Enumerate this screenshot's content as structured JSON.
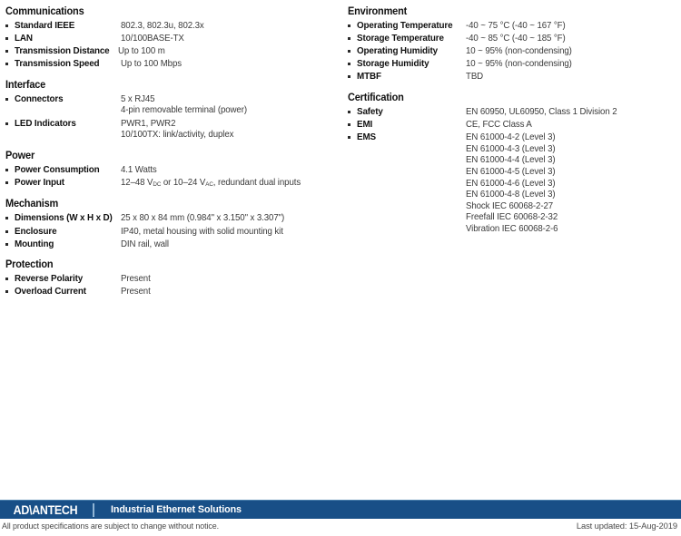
{
  "document": {
    "type": "product-specification-sheet"
  },
  "left_column": [
    {
      "title": "Communications",
      "rows": [
        {
          "label": "Standard IEEE",
          "values": [
            "802.3, 802.3u, 802.3x"
          ]
        },
        {
          "label": "LAN",
          "values": [
            "10/100BASE-TX"
          ]
        },
        {
          "label": "Transmission Distance",
          "values": [
            "Up to 100 m"
          ],
          "wide_label": true
        },
        {
          "label": "Transmission Speed",
          "values": [
            "Up to 100 Mbps"
          ]
        }
      ]
    },
    {
      "title": "Interface",
      "rows": [
        {
          "label": "Connectors",
          "values": [
            "5 x RJ45",
            "4-pin removable terminal (power)"
          ]
        },
        {
          "label": "LED Indicators",
          "values": [
            "PWR1, PWR2",
            "10/100TX: link/activity, duplex"
          ]
        }
      ]
    },
    {
      "title": "Power",
      "rows": [
        {
          "label": "Power Consumption",
          "values": [
            "4.1 Watts"
          ]
        },
        {
          "label": "Power Input",
          "values_html": [
            "12–48 V<sub>DC</sub> or 10–24 V<sub>AC</sub>, redundant dual inputs"
          ]
        }
      ]
    },
    {
      "title": "Mechanism",
      "rows": [
        {
          "label": "Dimensions (W x H x D)",
          "values": [
            "25 x 80 x 84 mm (0.984\" x 3.150\" x 3.307\")"
          ],
          "wide_label": true
        },
        {
          "label": "Enclosure",
          "values": [
            "IP40, metal housing with solid mounting kit"
          ]
        },
        {
          "label": "Mounting",
          "values": [
            "DIN rail, wall"
          ]
        }
      ]
    },
    {
      "title": "Protection",
      "rows": [
        {
          "label": "Reverse Polarity",
          "values": [
            "Present"
          ]
        },
        {
          "label": "Overload Current",
          "values": [
            "Present"
          ]
        }
      ]
    }
  ],
  "right_column": [
    {
      "title": "Environment",
      "rows": [
        {
          "label": "Operating Temperature",
          "values": [
            "-40 ~ 75 °C (-40 ~ 167 °F)"
          ],
          "wide_label": true
        },
        {
          "label": "Storage Temperature",
          "values": [
            "-40 ~ 85 °C (-40 ~ 185 °F)"
          ]
        },
        {
          "label": "Operating Humidity",
          "values": [
            "10 ~ 95% (non-condensing)"
          ]
        },
        {
          "label": "Storage Humidity",
          "values": [
            "10 ~ 95% (non-condensing)"
          ]
        },
        {
          "label": "MTBF",
          "values": [
            "TBD"
          ]
        }
      ]
    },
    {
      "title": "Certification",
      "rows": [
        {
          "label": "Safety",
          "values": [
            "EN 60950, UL60950, Class 1 Division 2"
          ]
        },
        {
          "label": "EMI",
          "values": [
            "CE, FCC Class A"
          ]
        },
        {
          "label": "EMS",
          "values": [
            "EN 61000-4-2 (Level 3)",
            "EN 61000-4-3 (Level 3)",
            "EN 61000-4-4 (Level 3)",
            "EN 61000-4-5 (Level 3)",
            "EN 61000-4-6 (Level 3)",
            "EN 61000-4-8 (Level 3)",
            "Shock IEC 60068-2-27",
            "Freefall IEC 60068-2-32",
            "Vibration IEC 60068-2-6"
          ]
        }
      ]
    }
  ],
  "footer": {
    "logo_text": "AD\\ANTECH",
    "tagline": "Industrial Ethernet Solutions",
    "disclaimer": "All product specifications are subject to change without notice.",
    "last_updated": "Last updated: 15-Aug-2019",
    "bar_color": "#184f87",
    "bar_top_edge_color": "#4a80ad"
  }
}
